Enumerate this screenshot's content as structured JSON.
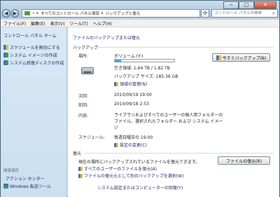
{
  "titlebar": {
    "minimize": "─",
    "maximize": "□",
    "close": "✕"
  },
  "address": {
    "back": "◀",
    "forward": "▶",
    "path_lead": "«",
    "path_root": "すべてのコントロール パネル項目",
    "path_current": "バックアップと復元",
    "refresh": "⟳",
    "search_placeholder": "コントロール パネルの検索",
    "search_icon": "⌕"
  },
  "menu": [
    "ファイル(F)",
    "編集(E)",
    "表示(V)",
    "ツール(T)",
    "ヘルプ(H)"
  ],
  "sidebar": {
    "home": "コントロール パネル ホーム",
    "links": [
      "スケジュールを無効にする",
      "システム イメージの作成",
      "システム修復ディスクの作成"
    ],
    "see_also": "関連項目",
    "bottom_links": [
      "アクション センター",
      "Windows 転送ツール"
    ]
  },
  "main": {
    "heading": "ファイルのバックアップまたは復元",
    "backup_section": "バックアップ",
    "location_label": "場所:",
    "location_value": "ボリューム (Y:)",
    "free_space": "空き領域: 1.64 TB / 1.82 TB",
    "usage_fraction": 0.1,
    "backup_size": "バックアップ サイズ: 185.36 GB",
    "manage_space": "領域の管理(N)",
    "backup_now": "今すぐバックアップ(B)",
    "next_label": "次回:",
    "next_value": "2010/09/19 19:00",
    "last_label": "前回:",
    "last_value": "2010/09/18 2:53",
    "contents_label": "内容:",
    "contents_value": "ライブラリおよびすべてのユーザーの個人用フォルダーのファイル、選択されたフォルダー および システム イメージ",
    "schedule_label": "スケジュール:",
    "schedule_value": "毎週日曜日の 19:00",
    "change_settings": "設定の変更(C)",
    "restore_section": "復元",
    "restore_text": "現在の場所にバックアップされているファイルを復元できます。",
    "restore_all_users": "すべてのユーザーのファイルを復元(A)",
    "restore_other": "ファイルの復元元として別のバックアップを選択(W)",
    "restore_files": "ファイルの復元(R)",
    "recover_system": "システム設定またはコンピューターの回復(Y)"
  }
}
